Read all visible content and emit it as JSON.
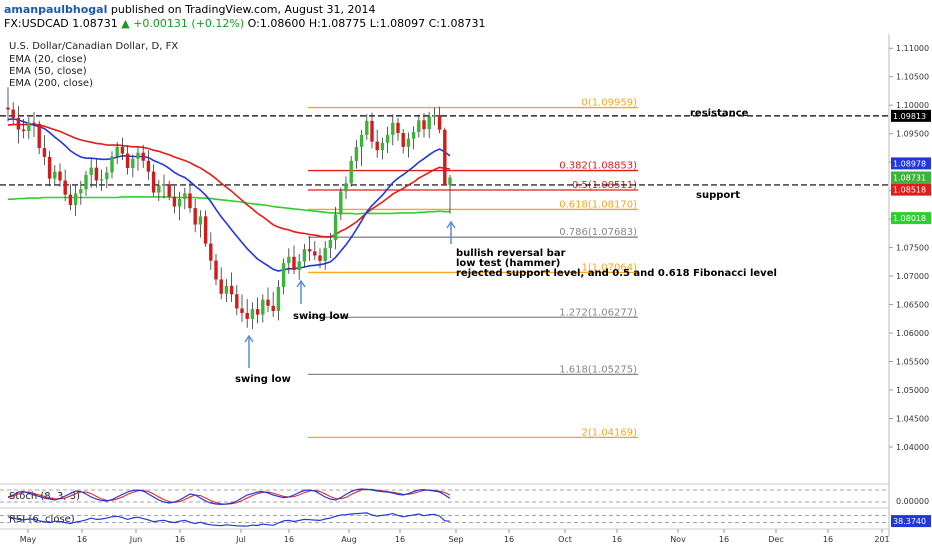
{
  "header": {
    "author": "amanpaulbhogal",
    "published_text": "published on TradingView.com, August 31, 2014",
    "symbol": "FX:USDCAD",
    "last": "1.08731",
    "change": "▲ +0.00131 (+0.12%)",
    "open": "O:1.08600",
    "high": "H:1.08775",
    "low": "L:1.08097",
    "close": "C:1.08731"
  },
  "legend": {
    "title": "U.S. Dollar/Canadian Dollar, D, FX",
    "ema20": "EMA (20, close)",
    "ema50": "EMA (50, close)",
    "ema200": "EMA (200, close)"
  },
  "colors": {
    "up": "#3ab53a",
    "down": "#d21b1b",
    "ema20": "#2238d8",
    "ema50": "#e41b1b",
    "ema200": "#2bd22b",
    "fib_orange": "#f5a623",
    "fib_red": "#e41b1b",
    "fib_gray": "#888888",
    "hline": "#000000",
    "arrow": "#5b8fd0"
  },
  "chart_data": {
    "type": "candlestick",
    "ylim": [
      1.0335,
      1.1125
    ],
    "y_ticks": [
      "1.11000",
      "1.10500",
      "1.10000",
      "1.09500",
      "1.09000",
      "1.08500",
      "1.08000",
      "1.07500",
      "1.07000",
      "1.06500",
      "1.06000",
      "1.05500",
      "1.05000",
      "1.04500",
      "1.04000"
    ],
    "x_ticks": [
      "May",
      "16",
      "Jun",
      "16",
      "Jul",
      "16",
      "Aug",
      "16",
      "Sep",
      "16",
      "Oct",
      "16",
      "Nov",
      "16",
      "Dec",
      "16",
      "201"
    ],
    "price_labels": [
      {
        "text": "1.09813",
        "value": 1.09813,
        "color": "#000000"
      },
      {
        "text": "1.08978",
        "value": 1.08978,
        "color": "#2238d8"
      },
      {
        "text": "1.08731",
        "value": 1.08731,
        "color": "#3ab53a"
      },
      {
        "text": "1.08518",
        "value": 1.08518,
        "color": "#e41b1b"
      },
      {
        "text": "1.08018",
        "value": 1.08018,
        "color": "#2bd22b"
      }
    ],
    "fibonacci": [
      {
        "label": "0(1.09959)",
        "value": 1.09959,
        "color": "#f5a623"
      },
      {
        "label": "0.382(1.08853)",
        "value": 1.08853,
        "color": "#e41b1b"
      },
      {
        "label": "0.5(1.08511)",
        "value": 1.08511,
        "color": "#e41b1b"
      },
      {
        "label": "0.618(1.08170)",
        "value": 1.0817,
        "color": "#f5a623"
      },
      {
        "label": "0.786(1.07683)",
        "value": 1.07683,
        "color": "#888888"
      },
      {
        "label": "1(1.07064)",
        "value": 1.07064,
        "color": "#f5a623"
      },
      {
        "label": "1.272(1.06277)",
        "value": 1.06277,
        "color": "#888888"
      },
      {
        "label": "1.618(1.05275)",
        "value": 1.05275,
        "color": "#888888"
      },
      {
        "label": "2(1.04169)",
        "value": 1.04169,
        "color": "#f5a623"
      }
    ],
    "resistance": 1.09813,
    "support": 1.086,
    "annotations": {
      "resistance": "resistance",
      "support": "support",
      "swing_low_1": "swing low",
      "swing_low_2": "swing low",
      "note1": "bullish reversal bar",
      "note2": "low test (hammer)",
      "note3": "rejected support level, and 0.5 and 0.618 Fibonacci level"
    },
    "candles": [
      [
        1.09958,
        1.10315,
        1.09711,
        1.09924
      ],
      [
        1.09924,
        1.10052,
        1.09666,
        1.09777
      ],
      [
        1.09777,
        1.09983,
        1.09328,
        1.09572
      ],
      [
        1.09572,
        1.0976,
        1.09418,
        1.09546
      ],
      [
        1.09546,
        1.0979,
        1.09406,
        1.09695
      ],
      [
        1.09695,
        1.09883,
        1.09442,
        1.09674
      ],
      [
        1.09674,
        1.09728,
        1.09142,
        1.09247
      ],
      [
        1.09247,
        1.09475,
        1.08948,
        1.09093
      ],
      [
        1.09093,
        1.09195,
        1.08578,
        1.08712
      ],
      [
        1.08712,
        1.08949,
        1.08591,
        1.08835
      ],
      [
        1.08835,
        1.08979,
        1.08569,
        1.08678
      ],
      [
        1.08678,
        1.08869,
        1.08313,
        1.0843
      ],
      [
        1.0843,
        1.08615,
        1.08155,
        1.08247
      ],
      [
        1.08247,
        1.08609,
        1.08053,
        1.08452
      ],
      [
        1.08452,
        1.08671,
        1.08252,
        1.08524
      ],
      [
        1.08524,
        1.0885,
        1.08408,
        1.08776
      ],
      [
        1.08776,
        1.09067,
        1.0855,
        1.08904
      ],
      [
        1.08904,
        1.09051,
        1.08552,
        1.08678
      ],
      [
        1.08678,
        1.08871,
        1.08499,
        1.08701
      ],
      [
        1.08701,
        1.08918,
        1.08542,
        1.08819
      ],
      [
        1.08819,
        1.09191,
        1.08713,
        1.09102
      ],
      [
        1.09102,
        1.09351,
        1.08968,
        1.09267
      ],
      [
        1.09267,
        1.09429,
        1.09037,
        1.09151
      ],
      [
        1.09151,
        1.09295,
        1.08781,
        1.08897
      ],
      [
        1.08897,
        1.09133,
        1.08733,
        1.0906
      ],
      [
        1.0906,
        1.09263,
        1.08846,
        1.09167
      ],
      [
        1.09167,
        1.09305,
        1.08897,
        1.09025
      ],
      [
        1.09025,
        1.09209,
        1.08691,
        1.08833
      ],
      [
        1.08833,
        1.08959,
        1.08402,
        1.08467
      ],
      [
        1.08467,
        1.0869,
        1.08319,
        1.08592
      ],
      [
        1.08592,
        1.08784,
        1.08363,
        1.08614
      ],
      [
        1.08614,
        1.08673,
        1.08331,
        1.08394
      ],
      [
        1.08394,
        1.08582,
        1.08098,
        1.08221
      ],
      [
        1.08221,
        1.08483,
        1.07978,
        1.08354
      ],
      [
        1.08354,
        1.08551,
        1.08175,
        1.08451
      ],
      [
        1.08451,
        1.08653,
        1.08112,
        1.08193
      ],
      [
        1.08193,
        1.08357,
        1.0777,
        1.07905
      ],
      [
        1.07905,
        1.08155,
        1.07675,
        1.08049
      ],
      [
        1.08049,
        1.08152,
        1.07512,
        1.07571
      ],
      [
        1.07571,
        1.07769,
        1.07109,
        1.07272
      ],
      [
        1.07272,
        1.07388,
        1.06842,
        1.06941
      ],
      [
        1.06941,
        1.07155,
        1.06593,
        1.06689
      ],
      [
        1.06689,
        1.06947,
        1.06546,
        1.06829
      ],
      [
        1.06829,
        1.07064,
        1.06546,
        1.06681
      ],
      [
        1.06681,
        1.0684,
        1.06316,
        1.06432
      ],
      [
        1.06432,
        1.06677,
        1.06196,
        1.06353
      ],
      [
        1.06353,
        1.06597,
        1.06092,
        1.06249
      ],
      [
        1.06249,
        1.06539,
        1.06071,
        1.0642
      ],
      [
        1.0642,
        1.06624,
        1.06171,
        1.06324
      ],
      [
        1.06324,
        1.06679,
        1.06184,
        1.06586
      ],
      [
        1.06586,
        1.06799,
        1.06365,
        1.06479
      ],
      [
        1.06479,
        1.06723,
        1.06281,
        1.06386
      ],
      [
        1.06386,
        1.06929,
        1.06222,
        1.06808
      ],
      [
        1.06808,
        1.07309,
        1.06682,
        1.07227
      ],
      [
        1.07227,
        1.07488,
        1.07041,
        1.07338
      ],
      [
        1.07338,
        1.07536,
        1.07037,
        1.07107
      ],
      [
        1.07107,
        1.07387,
        1.06934,
        1.07256
      ],
      [
        1.07256,
        1.07565,
        1.07151,
        1.07473
      ],
      [
        1.07473,
        1.07697,
        1.07268,
        1.07433
      ],
      [
        1.07433,
        1.07613,
        1.0728,
        1.07362
      ],
      [
        1.07362,
        1.07487,
        1.07139,
        1.07266
      ],
      [
        1.07266,
        1.07616,
        1.07111,
        1.07491
      ],
      [
        1.07491,
        1.07754,
        1.07318,
        1.07632
      ],
      [
        1.07632,
        1.08215,
        1.07472,
        1.08081
      ],
      [
        1.08081,
        1.08555,
        1.07985,
        1.08488
      ],
      [
        1.08488,
        1.08749,
        1.08351,
        1.08629
      ],
      [
        1.08629,
        1.09106,
        1.08569,
        1.0902
      ],
      [
        1.0902,
        1.09386,
        1.08885,
        1.09268
      ],
      [
        1.09268,
        1.09564,
        1.08935,
        1.09479
      ],
      [
        1.09479,
        1.09844,
        1.09394,
        1.09725
      ],
      [
        1.09725,
        1.09869,
        1.09239,
        1.0936
      ],
      [
        1.0936,
        1.09572,
        1.09076,
        1.09211
      ],
      [
        1.09211,
        1.09428,
        1.09048,
        1.09341
      ],
      [
        1.09341,
        1.09625,
        1.09161,
        1.09479
      ],
      [
        1.09479,
        1.09839,
        1.09296,
        1.09691
      ],
      [
        1.09691,
        1.09779,
        1.09376,
        1.09512
      ],
      [
        1.09512,
        1.09579,
        1.09153,
        1.09268
      ],
      [
        1.09268,
        1.09519,
        1.0908,
        1.09412
      ],
      [
        1.09412,
        1.09629,
        1.09225,
        1.09528
      ],
      [
        1.09528,
        1.09834,
        1.09432,
        1.09735
      ],
      [
        1.09735,
        1.09864,
        1.09434,
        1.09579
      ],
      [
        1.09579,
        1.09886,
        1.09421,
        1.09804
      ],
      [
        1.09804,
        1.09959,
        1.09647,
        1.09825
      ],
      [
        1.09825,
        1.09974,
        1.09508,
        1.09569
      ],
      [
        1.09569,
        1.09606,
        1.08697,
        1.086
      ],
      [
        1.086,
        1.08775,
        1.08097,
        1.08731
      ]
    ],
    "ema20": [
      1.0975,
      1.0976,
      1.0974,
      1.0971,
      1.0968,
      1.0965,
      1.0962,
      1.0959,
      1.0952,
      1.0944,
      1.0937,
      1.0929,
      1.092,
      1.0914,
      1.0909,
      1.0907,
      1.0907,
      1.0906,
      1.0905,
      1.0905,
      1.0906,
      1.0909,
      1.0911,
      1.0911,
      1.091,
      1.091,
      1.091,
      1.0908,
      1.0903,
      1.0899,
      1.0895,
      1.0889,
      1.0882,
      1.0877,
      1.0873,
      1.0866,
      1.0858,
      1.0851,
      1.0842,
      1.0831,
      1.0817,
      1.0804,
      1.0793,
      1.0781,
      1.077,
      1.0759,
      1.0748,
      1.0739,
      1.073,
      1.0724,
      1.0718,
      1.0712,
      1.0709,
      1.0711,
      1.0713,
      1.0713,
      1.0714,
      1.0716,
      1.0718,
      1.0719,
      1.072,
      1.0722,
      1.0725,
      1.0733,
      1.0744,
      1.0755,
      1.0768,
      1.0782,
      1.0797,
      1.0813,
      1.0824,
      1.0833,
      1.0842,
      1.0853,
      1.0864,
      1.0872,
      1.0878,
      1.0885,
      1.0892,
      1.09,
      1.0906,
      1.0913,
      1.0919,
      1.0923,
      1.0918,
      1.0911
    ],
    "ema50": [
      1.0965,
      1.0966,
      1.0966,
      1.0966,
      1.0966,
      1.0966,
      1.0965,
      1.0963,
      1.096,
      1.0957,
      1.0954,
      1.095,
      1.0946,
      1.0942,
      1.0939,
      1.0937,
      1.0935,
      1.0933,
      1.0932,
      1.093,
      1.093,
      1.093,
      1.0929,
      1.0928,
      1.0927,
      1.0927,
      1.0926,
      1.0924,
      1.0921,
      1.0919,
      1.0916,
      1.0913,
      1.0909,
      1.0906,
      1.0903,
      1.0899,
      1.0894,
      1.089,
      1.0884,
      1.0878,
      1.0871,
      1.0863,
      1.0856,
      1.0849,
      1.0841,
      1.0833,
      1.0825,
      1.0818,
      1.081,
      1.0804,
      1.0797,
      1.079,
      1.0786,
      1.0783,
      1.0781,
      1.0778,
      1.0776,
      1.0775,
      1.0773,
      1.0772,
      1.077,
      1.0769,
      1.0769,
      1.0773,
      1.0779,
      1.0783,
      1.0789,
      1.0795,
      1.0803,
      1.0811,
      1.0818,
      1.0824,
      1.083,
      1.0837,
      1.0844,
      1.0849,
      1.0854,
      1.086,
      1.0865,
      1.0872,
      1.0877,
      1.0882,
      1.0887,
      1.0891,
      1.0889,
      1.0888
    ],
    "ema200": [
      1.0835,
      1.0835,
      1.0836,
      1.0836,
      1.0837,
      1.0837,
      1.0837,
      1.0838,
      1.0838,
      1.0838,
      1.0838,
      1.0838,
      1.0838,
      1.0838,
      1.0838,
      1.0838,
      1.0838,
      1.0838,
      1.0838,
      1.0838,
      1.0838,
      1.0838,
      1.0839,
      1.0839,
      1.0839,
      1.0839,
      1.0839,
      1.0839,
      1.0839,
      1.0839,
      1.0839,
      1.0839,
      1.0838,
      1.0838,
      1.0838,
      1.0838,
      1.0838,
      1.0837,
      1.0837,
      1.0836,
      1.0835,
      1.0834,
      1.0833,
      1.0832,
      1.0831,
      1.083,
      1.0828,
      1.0827,
      1.0826,
      1.0825,
      1.0824,
      1.0822,
      1.0821,
      1.082,
      1.0819,
      1.0818,
      1.0817,
      1.0816,
      1.0815,
      1.0814,
      1.0813,
      1.0812,
      1.0811,
      1.0811,
      1.081,
      1.081,
      1.081,
      1.0809,
      1.081,
      1.081,
      1.081,
      1.081,
      1.081,
      1.081,
      1.081,
      1.0811,
      1.0811,
      1.0811,
      1.0811,
      1.0812,
      1.0812,
      1.0813,
      1.0813,
      1.0814,
      1.0813,
      1.0813
    ],
    "stoch": {
      "label": "Stoch (8, 3, 3)",
      "value_label": "0.00000",
      "k": [
        45,
        55,
        70,
        72,
        65,
        55,
        48,
        40,
        35,
        30,
        38,
        50,
        62,
        75,
        72,
        60,
        45,
        35,
        28,
        25,
        32,
        45,
        58,
        70,
        78,
        80,
        75,
        60,
        45,
        30,
        20,
        15,
        20,
        30,
        45,
        60,
        55,
        40,
        25,
        15,
        10,
        8,
        10,
        15,
        25,
        40,
        55,
        62,
        70,
        72,
        65,
        55,
        48,
        42,
        45,
        55,
        68,
        78,
        80,
        75,
        60,
        45,
        35,
        30,
        42,
        58,
        72,
        82,
        85,
        83,
        80,
        75,
        72,
        70,
        65,
        58,
        55,
        62,
        72,
        80,
        82,
        78,
        75,
        70,
        55,
        38
      ],
      "d": [
        42,
        50,
        60,
        68,
        70,
        63,
        55,
        48,
        41,
        36,
        35,
        40,
        50,
        62,
        70,
        70,
        62,
        48,
        36,
        29,
        28,
        35,
        45,
        58,
        68,
        76,
        78,
        72,
        60,
        45,
        32,
        22,
        18,
        22,
        32,
        45,
        55,
        52,
        40,
        27,
        17,
        11,
        9,
        11,
        17,
        27,
        40,
        52,
        62,
        68,
        70,
        64,
        56,
        48,
        45,
        47,
        56,
        67,
        75,
        78,
        72,
        60,
        47,
        37,
        36,
        43,
        57,
        70,
        80,
        83,
        83,
        79,
        76,
        72,
        69,
        64,
        59,
        58,
        63,
        71,
        78,
        80,
        78,
        74,
        67,
        55
      ]
    },
    "rsi": {
      "label": "RSI (6, close)",
      "value_label": "38.3740",
      "values": [
        62,
        55,
        48,
        45,
        50,
        48,
        40,
        35,
        30,
        38,
        35,
        30,
        25,
        33,
        38,
        45,
        55,
        48,
        50,
        55,
        62,
        65,
        58,
        48,
        56,
        60,
        52,
        45,
        35,
        40,
        42,
        35,
        30,
        38,
        42,
        32,
        25,
        32,
        22,
        18,
        15,
        13,
        18,
        15,
        12,
        11,
        10,
        16,
        14,
        22,
        18,
        15,
        28,
        40,
        42,
        36,
        42,
        48,
        46,
        44,
        42,
        50,
        55,
        65,
        72,
        74,
        78,
        80,
        82,
        84,
        72,
        66,
        70,
        74,
        80,
        70,
        62,
        68,
        72,
        78,
        68,
        74,
        76,
        66,
        40,
        38
      ]
    }
  }
}
